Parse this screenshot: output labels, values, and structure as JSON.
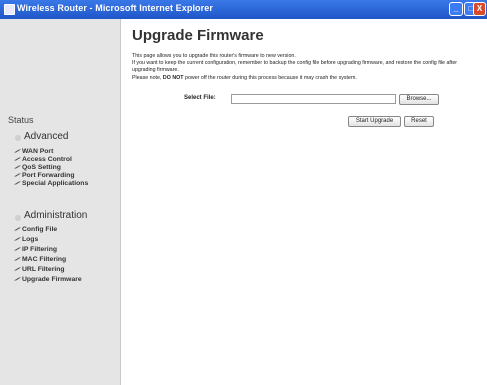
{
  "window": {
    "title": "Wireless Router - Microsoft Internet Explorer",
    "min_glyph": "_",
    "max_glyph": "□",
    "close_glyph": "X"
  },
  "sidebar": {
    "section_title": "Status",
    "groups": [
      {
        "title": "Advanced",
        "items": [
          "WAN Port",
          "Access Control",
          "QoS Setting",
          "Port Forwarding",
          "Special Applications"
        ]
      },
      {
        "title": "Administration",
        "items": [
          "Config File",
          "Logs",
          "IP Filtering",
          "MAC Filtering",
          "URL Filtering",
          "Upgrade Firmware"
        ]
      }
    ],
    "item_icon": "pencil-icon"
  },
  "main": {
    "title": "Upgrade Firmware",
    "desc_line1": "This page allows you to upgrade this router's firmware to new version.",
    "desc_line2": "If you want to keep the current configuration, remember to backup the config file before upgrading firmware, and restore the config file after upgrading firmware.",
    "desc_line3_pre": "Please note, ",
    "desc_line3_bold": "DO NOT",
    "desc_line3_post": " power off the router during this process because it may crash the system.",
    "file_label": "Select File:",
    "file_value": "",
    "browse_label": "Browse...",
    "start_label": "Start Upgrade",
    "reset_label": "Reset"
  },
  "colors": {
    "titlebar": "#1f56c8",
    "sidebar_bg": "#e5e5e5",
    "close_button": "#d94a2a"
  }
}
